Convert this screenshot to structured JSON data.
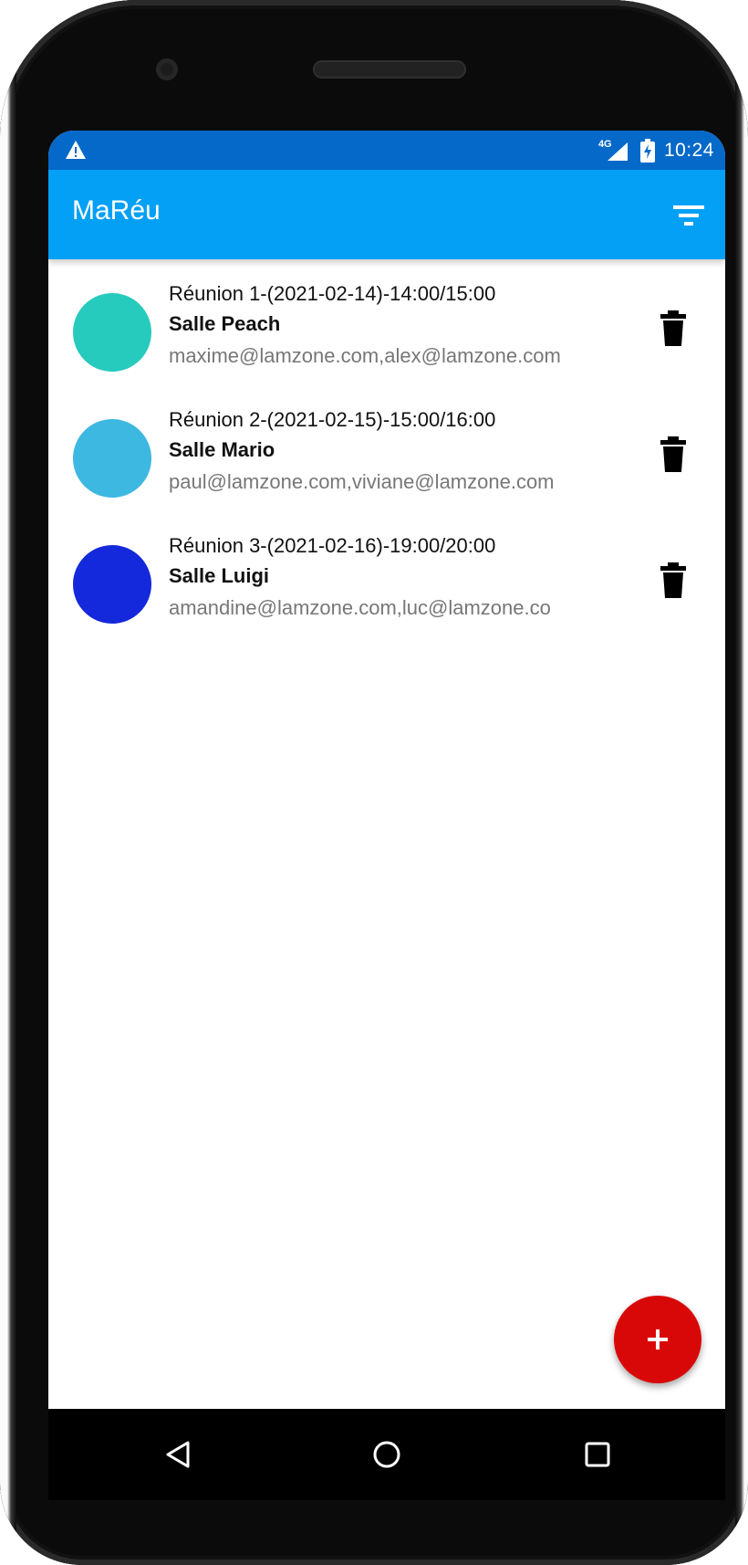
{
  "status_bar": {
    "network_label": "4G",
    "time": "10:24"
  },
  "app_bar": {
    "title": "MaRéu",
    "filter_icon": "filter-icon"
  },
  "meetings": [
    {
      "title": "Réunion 1-(2021-02-14)-14:00/15:00",
      "room": "Salle Peach",
      "emails": "maxime@lamzone.com,alex@lamzone.com",
      "color": "#26cbbd"
    },
    {
      "title": "Réunion 2-(2021-02-15)-15:00/16:00",
      "room": "Salle Mario",
      "emails": "paul@lamzone.com,viviane@lamzone.com",
      "color": "#3db8e0"
    },
    {
      "title": "Réunion 3-(2021-02-16)-19:00/20:00",
      "room": "Salle Luigi",
      "emails": "amandine@lamzone.com,luc@lamzone.co",
      "color": "#1428dc"
    }
  ],
  "fab": {
    "label": "+",
    "color": "#d90808"
  },
  "colors": {
    "status_bar": "#0569c9",
    "app_bar": "#03a0f5"
  },
  "nav_bar": {
    "back_icon": "back-icon",
    "home_icon": "home-icon",
    "recents_icon": "recents-icon"
  }
}
